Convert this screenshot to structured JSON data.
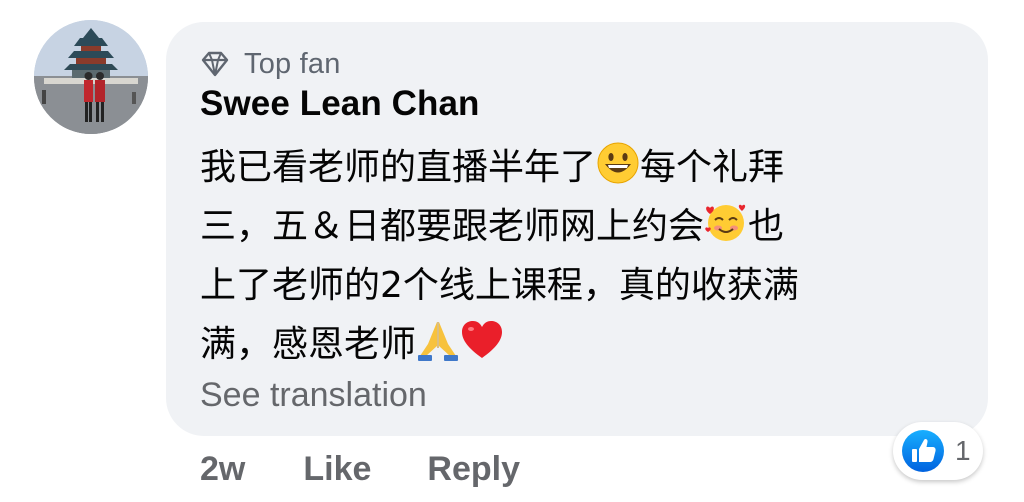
{
  "author": {
    "badge_icon": "diamond-icon",
    "badge_label": "Top fan",
    "name": "Swee Lean Chan"
  },
  "comment": {
    "lines": [
      "我已看老师的直播半年了",
      "每个礼拜",
      "三，五＆日都要跟老师网上约会",
      "也",
      "上了老师的2个线上课程，真的收获满",
      "满，感恩老师"
    ],
    "emojis": [
      "grinning-face",
      "smiling-face-with-hearts",
      "folded-hands",
      "red-heart"
    ],
    "see_translation": "See translation"
  },
  "actions": {
    "time_ago": "2w",
    "like_label": "Like",
    "reply_label": "Reply"
  },
  "reactions": {
    "icon": "thumbs-up-icon",
    "count": "1"
  },
  "colors": {
    "bubble_bg": "#f0f2f5",
    "text": "#050505",
    "muted": "#65676b",
    "like_blue": "#1877f2"
  }
}
